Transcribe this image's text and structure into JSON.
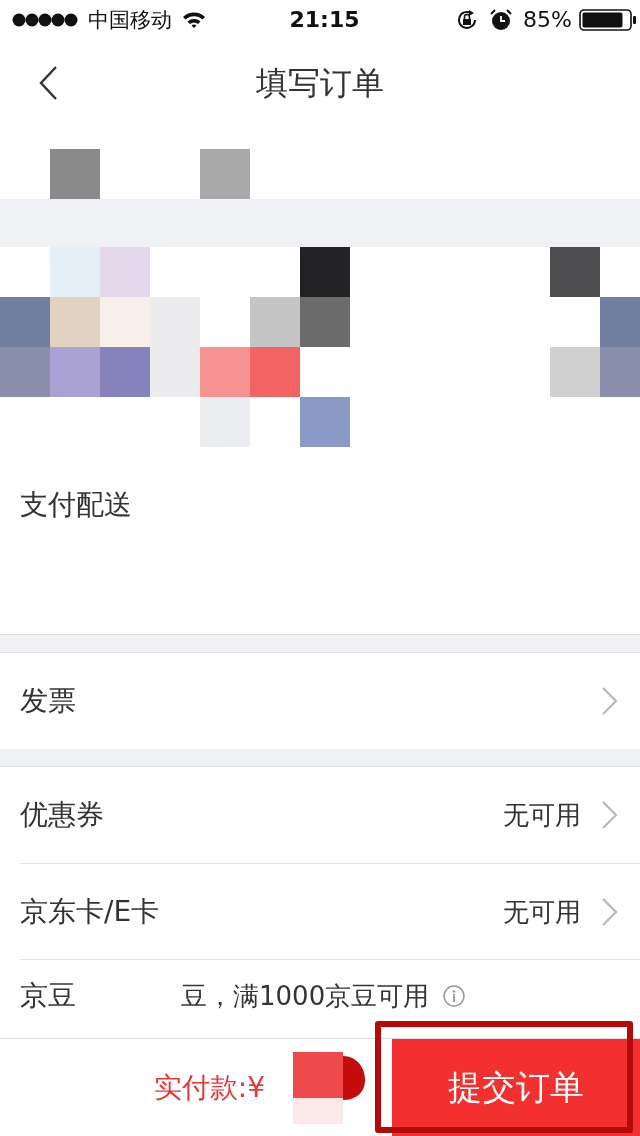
{
  "status_bar": {
    "carrier": "中国移动",
    "time": "21:15",
    "battery": "85%"
  },
  "nav_bar": {
    "title": "填写订单"
  },
  "payment_delivery": {
    "title": "支付配送"
  },
  "groups": [
    {
      "rows": [
        {
          "kind": "link",
          "label": "发票"
        }
      ]
    },
    {
      "rows": [
        {
          "kind": "link",
          "label": "优惠券",
          "value": "无可用"
        },
        {
          "kind": "link",
          "label": "京东卡/E卡",
          "value": "无可用"
        },
        {
          "kind": "info",
          "label": "京豆",
          "note": "豆，满1000京豆可用"
        }
      ]
    }
  ],
  "bottom_bar": {
    "total_label": "实付款:¥",
    "submit": {
      "label": "提交订单",
      "highlighted": true
    }
  }
}
